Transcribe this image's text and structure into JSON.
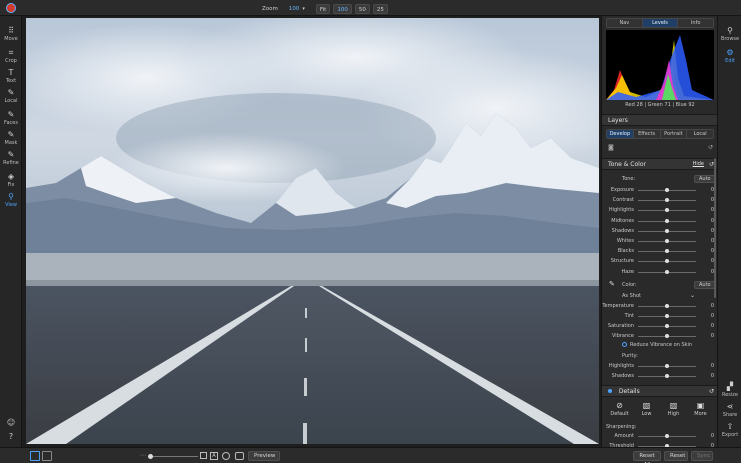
{
  "topbar": {
    "zoom_label": "Zoom",
    "zoom_value": "100",
    "fit": "Fit",
    "z100": "100",
    "z50": "50",
    "z25": "25"
  },
  "tools": [
    {
      "icon": "move-icon",
      "glyph": "⠿",
      "label": "Move"
    },
    {
      "icon": "crop-icon",
      "glyph": "⌗",
      "label": "Crop"
    },
    {
      "icon": "text-icon",
      "glyph": "T",
      "label": "Text"
    },
    {
      "icon": "local-brush-icon",
      "glyph": "✎",
      "label": "Local"
    },
    {
      "icon": "faces-icon",
      "glyph": "✎",
      "label": "Faces"
    },
    {
      "icon": "mask-icon",
      "glyph": "✎",
      "label": "Mask"
    },
    {
      "icon": "refine-icon",
      "glyph": "✎",
      "label": "Refine"
    },
    {
      "icon": "fix-icon",
      "glyph": "◈",
      "label": "Fix"
    },
    {
      "icon": "view-icon",
      "glyph": "⚲",
      "label": "View"
    }
  ],
  "right_tools": [
    {
      "icon": "browse-icon",
      "glyph": "⚲",
      "label": "Browse"
    },
    {
      "icon": "edit-icon",
      "glyph": "⚙",
      "label": "Edit"
    }
  ],
  "right_tools_bottom": [
    {
      "icon": "resize-icon",
      "glyph": "▞",
      "label": "Resize"
    },
    {
      "icon": "share-icon",
      "glyph": "⋖",
      "label": "Share"
    },
    {
      "icon": "export-icon",
      "glyph": "⇧",
      "label": "Export"
    }
  ],
  "panel": {
    "top_tabs": [
      "Nav",
      "Levels",
      "Info"
    ],
    "rgb": {
      "red_label": "Red",
      "red": "28",
      "green_label": "Green",
      "green": "71",
      "blue_label": "Blue",
      "blue": "92"
    },
    "layers_title": "Layers",
    "layer_tabs": [
      "Develop",
      "Effects",
      "Portrait",
      "Local"
    ],
    "tone_title": "Tone & Color",
    "hide": "Hide",
    "tone_label": "Tone:",
    "auto": "Auto",
    "tone_rows": [
      {
        "label": "Exposure",
        "value": "0",
        "pos": 0.5
      },
      {
        "label": "Contrast",
        "value": "0",
        "pos": 0.5
      },
      {
        "label": "Highlights",
        "value": "0",
        "pos": 0.5
      },
      {
        "label": "Midtones",
        "value": "0",
        "pos": 0.5
      },
      {
        "label": "Shadows",
        "value": "0",
        "pos": 0.5
      },
      {
        "label": "Whites",
        "value": "0",
        "pos": 0.5
      },
      {
        "label": "Blacks",
        "value": "0",
        "pos": 0.5
      },
      {
        "label": "Structure",
        "value": "0",
        "pos": 0.5
      },
      {
        "label": "Haze",
        "value": "0",
        "pos": 0.5
      }
    ],
    "color_label": "Color:",
    "color_auto": "Auto",
    "wb_value": "As Shot",
    "color_rows": [
      {
        "label": "Temperature",
        "value": "0",
        "pos": 0.5
      },
      {
        "label": "Tint",
        "value": "0",
        "pos": 0.5
      },
      {
        "label": "Saturation",
        "value": "0",
        "pos": 0.5
      },
      {
        "label": "Vibrance",
        "value": "0",
        "pos": 0.5
      }
    ],
    "reduce_vibrance": "Reduce Vibrance on Skin",
    "purity_label": "Purity:",
    "purity_rows": [
      {
        "label": "Highlights",
        "value": "0",
        "pos": 0.5
      },
      {
        "label": "Shadows",
        "value": "0",
        "pos": 0.5
      }
    ],
    "details_title": "Details",
    "presets": [
      {
        "icon": "default-preset-icon",
        "label": "Default"
      },
      {
        "icon": "low-preset-icon",
        "label": "Low"
      },
      {
        "icon": "high-preset-icon",
        "label": "High"
      },
      {
        "icon": "more-preset-icon",
        "label": "More"
      }
    ],
    "sharpening_label": "Sharpening:",
    "sharp_rows": [
      {
        "label": "Amount",
        "value": "0",
        "pos": 0.5
      },
      {
        "label": "Threshold",
        "value": "0",
        "pos": 0.5
      }
    ]
  },
  "bottombar": {
    "preview": "Preview",
    "reset_all": "Reset All",
    "reset": "Reset",
    "sync": "Sync"
  }
}
